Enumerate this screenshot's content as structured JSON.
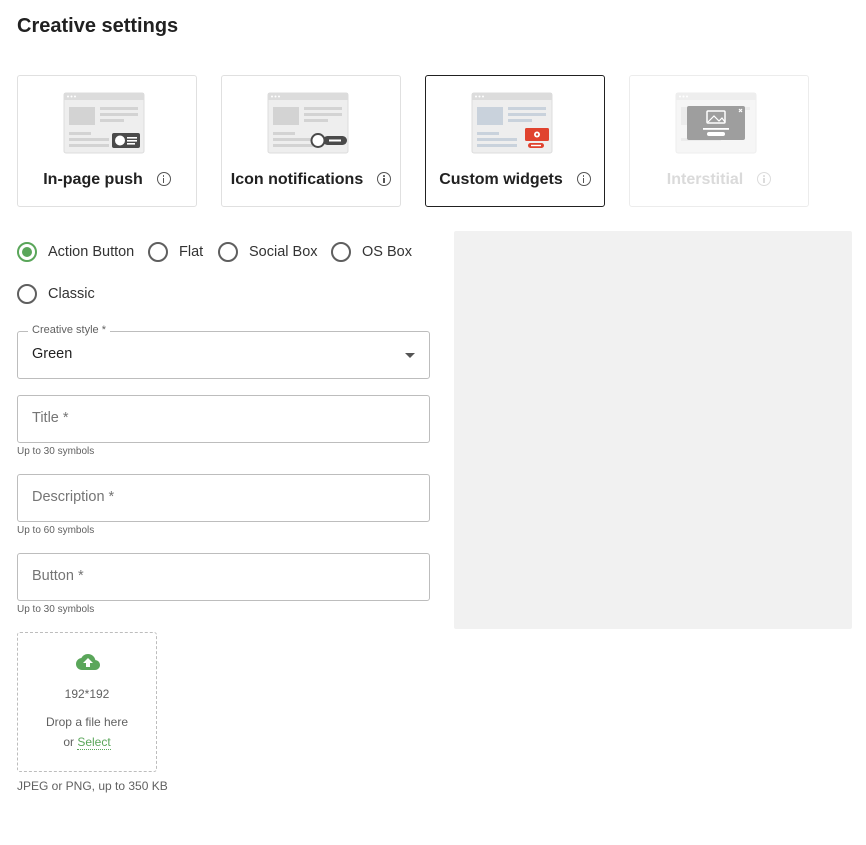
{
  "page": {
    "title": "Creative settings"
  },
  "formats": [
    {
      "label": "In-page push",
      "state": "normal",
      "icon": "in-page-push-thumbnail-icon"
    },
    {
      "label": "Icon notifications",
      "state": "normal",
      "icon": "icon-notifications-thumbnail-icon"
    },
    {
      "label": "Custom widgets",
      "state": "selected",
      "icon": "custom-widgets-thumbnail-icon"
    },
    {
      "label": "Interstitial",
      "state": "disabled",
      "icon": "interstitial-thumbnail-icon"
    }
  ],
  "styles": {
    "options": [
      "Action Button",
      "Flat",
      "Social Box",
      "OS Box",
      "Classic"
    ],
    "selected": "Action Button"
  },
  "creative_style": {
    "label": "Creative style *",
    "value": "Green"
  },
  "title_field": {
    "placeholder": "Title *",
    "hint": "Up to 30 symbols"
  },
  "description_field": {
    "placeholder": "Description *",
    "hint": "Up to 60 symbols"
  },
  "button_field": {
    "placeholder": "Button *",
    "hint": "Up to 30 symbols"
  },
  "upload": {
    "size": "192*192",
    "drop_text": "Drop a file here",
    "or_text": "or",
    "select_text": "Select",
    "hint": "JPEG or PNG, up to 350 KB"
  },
  "colors": {
    "accent": "#5aa65a",
    "red": "#e0432f",
    "border": "#bdbdbd",
    "preview_bg": "#f1f1f1"
  }
}
